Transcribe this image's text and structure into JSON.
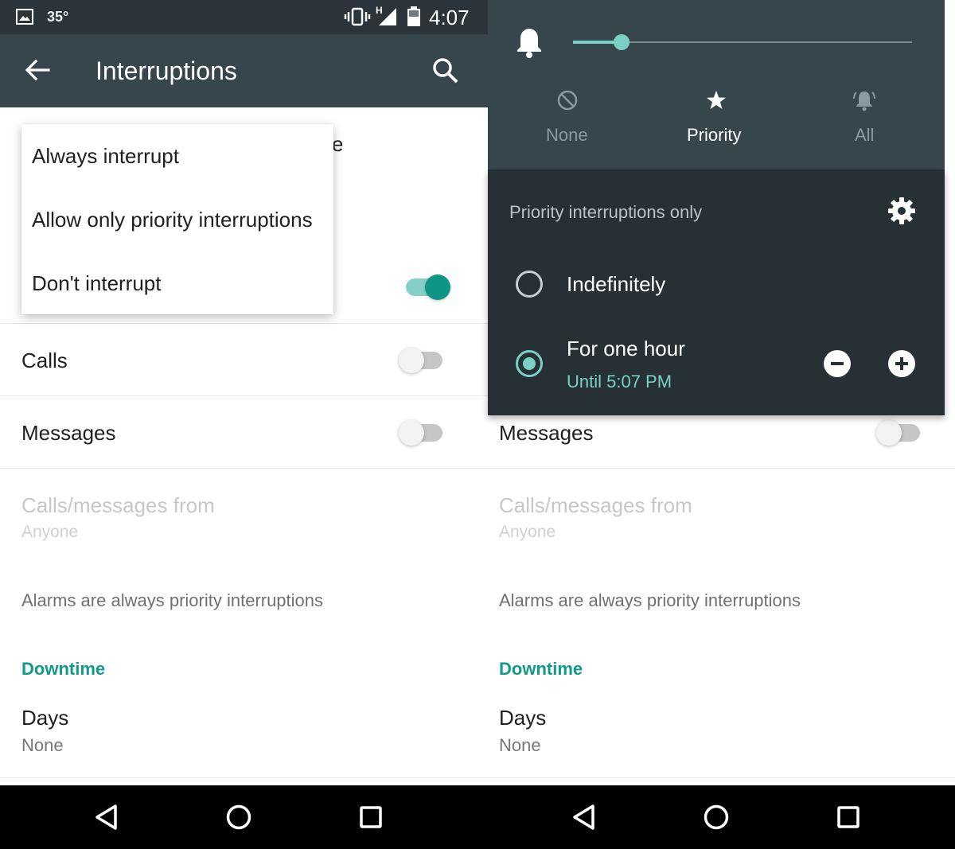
{
  "status_bar": {
    "temperature": "35°",
    "signal_type": "H",
    "time": "4:07",
    "icons": [
      "image-icon",
      "vibrate-icon",
      "cell-signal-icon",
      "battery-icon"
    ]
  },
  "app_bar": {
    "title": "Interruptions",
    "back_icon": "arrow-left-icon",
    "search_icon": "search-icon"
  },
  "left_screen": {
    "partial_text": "e",
    "popup_menu": {
      "items": [
        "Always interrupt",
        "Allow only priority interruptions",
        "Don't interrupt"
      ]
    },
    "main_toggle_on": true,
    "rows": {
      "calls": {
        "label": "Calls",
        "on": false
      },
      "messages": {
        "label": "Messages",
        "on": false
      }
    },
    "calls_messages_from": {
      "label": "Calls/messages from",
      "value": "Anyone"
    },
    "alarms_note": "Alarms are always priority interruptions",
    "downtime": {
      "header": "Downtime",
      "days_label": "Days",
      "days_value": "None"
    }
  },
  "right_screen": {
    "volume_level": 0.14,
    "modes": [
      {
        "label": "None",
        "icon": "no-interrupt-icon",
        "active": false
      },
      {
        "label": "Priority",
        "icon": "star-icon",
        "active": true
      },
      {
        "label": "All",
        "icon": "bell-ring-icon",
        "active": false
      }
    ],
    "priority_heading": "Priority interruptions only",
    "options": [
      {
        "label": "Indefinitely",
        "selected": false
      },
      {
        "label": "For one hour",
        "sublabel": "Until 5:07 PM",
        "selected": true
      }
    ],
    "messages": {
      "label": "Messages",
      "on": false
    },
    "calls_messages_from": {
      "label": "Calls/messages from",
      "value": "Anyone"
    },
    "alarms_note": "Alarms are always priority interruptions",
    "downtime": {
      "header": "Downtime",
      "days_label": "Days",
      "days_value": "None"
    }
  },
  "nav_bar": {
    "buttons": [
      "back-button",
      "home-button",
      "recents-button"
    ]
  },
  "colors": {
    "status_bar": "#2b343a",
    "app_bar": "#37454d",
    "accent": "#0f9585",
    "accent_light": "#79d1c6",
    "panel_dark": "#273035"
  }
}
